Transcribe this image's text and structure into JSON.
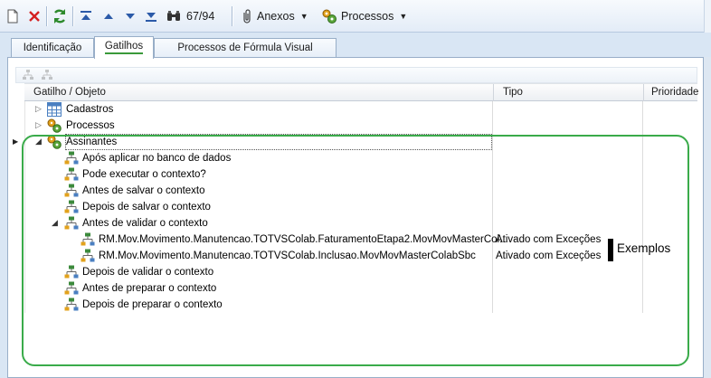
{
  "toolbar": {
    "record_position": "67/94",
    "attachments_label": "Anexos",
    "processes_label": "Processos",
    "icons": [
      "new-document-icon",
      "delete-icon",
      "refresh-icon",
      "first-record-icon",
      "previous-record-icon",
      "next-record-icon",
      "last-record-icon",
      "binoculars-icon",
      "paperclip-icon",
      "processes-icon"
    ]
  },
  "tabs": [
    {
      "label": "Identificação",
      "active": false
    },
    {
      "label": "Gatilhos",
      "active": true
    },
    {
      "label": "Processos de Fórmula Visual",
      "active": false
    }
  ],
  "grid": {
    "columns": [
      "Gatilho / Objeto",
      "Tipo",
      "Prioridade"
    ],
    "rows": [
      {
        "label": "Cadastros",
        "type": "",
        "level": 0,
        "expander": "collapsed",
        "icon": "grid-icon"
      },
      {
        "label": "Processos",
        "type": "",
        "level": 0,
        "expander": "collapsed",
        "icon": "processes-icon"
      },
      {
        "label": "Assinantes",
        "type": "",
        "level": 0,
        "expander": "expanded",
        "icon": "processes-icon"
      },
      {
        "label": "Após aplicar no banco de dados",
        "type": "",
        "level": 1,
        "expander": "none",
        "icon": "hierarchy-icon"
      },
      {
        "label": "Pode executar o contexto?",
        "type": "",
        "level": 1,
        "expander": "none",
        "icon": "hierarchy-icon"
      },
      {
        "label": "Antes de salvar o contexto",
        "type": "",
        "level": 1,
        "expander": "none",
        "icon": "hierarchy-icon"
      },
      {
        "label": "Depois de salvar o contexto",
        "type": "",
        "level": 1,
        "expander": "none",
        "icon": "hierarchy-icon"
      },
      {
        "label": "Antes de validar o contexto",
        "type": "",
        "level": 1,
        "expander": "expanded",
        "icon": "hierarchy-icon"
      },
      {
        "label": "RM.Mov.Movimento.Manutencao.TOTVSColab.FaturamentoEtapa2.MovMovMasterCol...",
        "type": "Ativado com Exceções",
        "level": 2,
        "expander": "none",
        "icon": "hierarchy-icon"
      },
      {
        "label": "RM.Mov.Movimento.Manutencao.TOTVSColab.Inclusao.MovMovMasterColabSbc",
        "type": "Ativado com Exceções",
        "level": 2,
        "expander": "none",
        "icon": "hierarchy-icon"
      },
      {
        "label": "Depois de validar o contexto",
        "type": "",
        "level": 1,
        "expander": "none",
        "icon": "hierarchy-icon"
      },
      {
        "label": "Antes de preparar o contexto",
        "type": "",
        "level": 1,
        "expander": "none",
        "icon": "hierarchy-icon"
      },
      {
        "label": "Depois de preparar o contexto",
        "type": "",
        "level": 1,
        "expander": "none",
        "icon": "hierarchy-icon"
      }
    ]
  },
  "annotation": {
    "label": "Exemplos",
    "box_color": "#3aab4a"
  },
  "colors": {
    "accent_green": "#3a9a3a",
    "background": "#d9e6f4"
  }
}
